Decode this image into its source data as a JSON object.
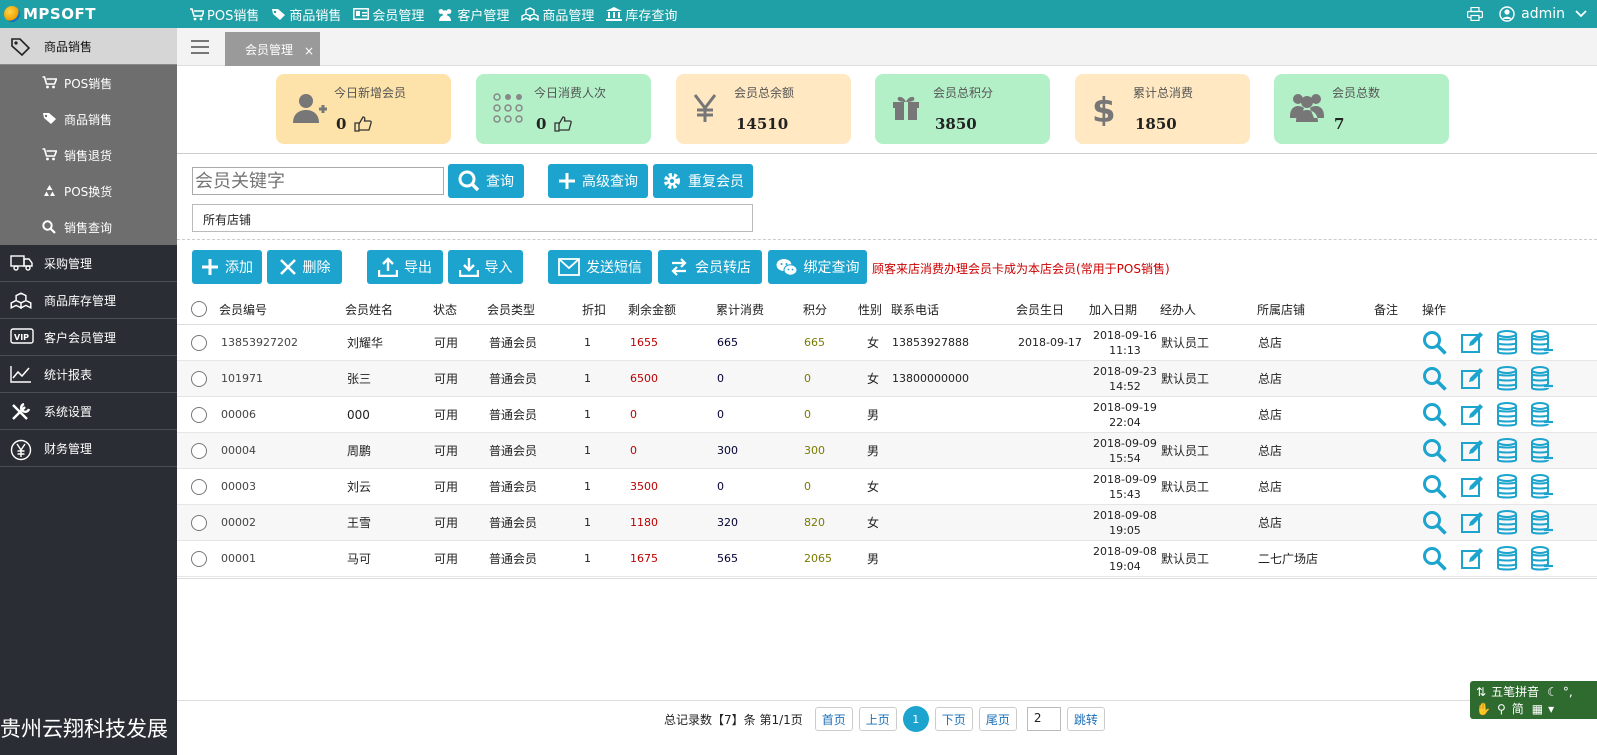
{
  "app": {
    "logo": "MPSOFT"
  },
  "topnav": [
    {
      "label": "POS销售",
      "icon": "cart-icon"
    },
    {
      "label": "商品销售",
      "icon": "tag-icon"
    },
    {
      "label": "会员管理",
      "icon": "id-card-icon"
    },
    {
      "label": "客户管理",
      "icon": "users-icon"
    },
    {
      "label": "商品管理",
      "icon": "cubes-icon"
    },
    {
      "label": "库存查询",
      "icon": "bank-icon"
    }
  ],
  "topright": {
    "user": "admin",
    "print_icon": "print-icon",
    "user_icon": "user-circle-icon",
    "dropdown_icon": "chevron-down-icon"
  },
  "sidebar": {
    "items": [
      {
        "label": "商品销售",
        "icon": "tags-icon",
        "active": true
      },
      {
        "label": "采购管理",
        "icon": "truck-icon"
      },
      {
        "label": "商品库存管理",
        "icon": "cubes-icon"
      },
      {
        "label": "客户会员管理",
        "icon": "vip-icon"
      },
      {
        "label": "统计报表",
        "icon": "line-chart-icon"
      },
      {
        "label": "系统设置",
        "icon": "tools-icon"
      },
      {
        "label": "财务管理",
        "icon": "yen-icon"
      }
    ],
    "subitems": [
      {
        "label": "POS销售",
        "icon": "cart-icon"
      },
      {
        "label": "商品销售",
        "icon": "tag-icon"
      },
      {
        "label": "销售退货",
        "icon": "cart-return-icon"
      },
      {
        "label": "POS换货",
        "icon": "recycle-icon"
      },
      {
        "label": "销售查询",
        "icon": "search-icon"
      }
    ],
    "footer_text": "贵州云翔科技发展"
  },
  "tabs": [
    {
      "label": "会员管理",
      "close": "×"
    }
  ],
  "stats": [
    {
      "title": "今日新增会员",
      "value": "0",
      "icon": "user-plus-icon",
      "color": "#fde3a9"
    },
    {
      "title": "今日消费人次",
      "value": "0",
      "icon": "dots-grid-icon",
      "color": "#b3f0c8"
    },
    {
      "title": "会员总余额",
      "value": "14510",
      "icon": "yen-icon",
      "color": "#ffe8c2"
    },
    {
      "title": "会员总积分",
      "value": "3850",
      "icon": "gift-icon",
      "color": "#b3f0c8"
    },
    {
      "title": "累计总消费",
      "value": "1850",
      "icon": "dollar-icon",
      "color": "#ffe8c2"
    },
    {
      "title": "会员总数",
      "value": "7",
      "icon": "group-icon",
      "color": "#b3f0c8"
    }
  ],
  "search": {
    "placeholder": "会员关键字",
    "query_label": "查询",
    "advanced_label": "高级查询",
    "duplicate_label": "重复会员",
    "store_selected": "所有店铺"
  },
  "toolbar": {
    "add": "添加",
    "delete": "删除",
    "export": "导出",
    "import": "导入",
    "sms": "发送短信",
    "transfer": "会员转店",
    "wechat": "绑定查询",
    "notice": "顾客来店消费办理会员卡成为本店会员(常用于POS销售)"
  },
  "table": {
    "headers": [
      "会员编号",
      "会员姓名",
      "状态",
      "会员类型",
      "折扣",
      "剩余金额",
      "累计消费",
      "积分",
      "性别",
      "联系电话",
      "会员生日",
      "加入日期",
      "经办人",
      "所属店铺",
      "备注",
      "操作"
    ],
    "rows": [
      {
        "id": "13853927202",
        "name": "刘耀华",
        "status": "可用",
        "type": "普通会员",
        "discount": "1",
        "balance": "1655",
        "total": "665",
        "points": "665",
        "gender": "女",
        "phone": "13853927888",
        "birthday": "2018-09-17",
        "join_date": "2018-09-16",
        "join_time": "11:13",
        "handler": "默认员工",
        "store": "总店",
        "note": ""
      },
      {
        "id": "101971",
        "name": "张三",
        "status": "可用",
        "type": "普通会员",
        "discount": "1",
        "balance": "6500",
        "total": "0",
        "points": "0",
        "gender": "女",
        "phone": "13800000000",
        "birthday": "",
        "join_date": "2018-09-23",
        "join_time": "14:52",
        "handler": "默认员工",
        "store": "总店",
        "note": ""
      },
      {
        "id": "00006",
        "name": "000",
        "status": "可用",
        "type": "普通会员",
        "discount": "1",
        "balance": "0",
        "total": "0",
        "points": "0",
        "gender": "男",
        "phone": "",
        "birthday": "",
        "join_date": "2018-09-19",
        "join_time": "22:04",
        "handler": "",
        "store": "总店",
        "note": ""
      },
      {
        "id": "00004",
        "name": "周鹏",
        "status": "可用",
        "type": "普通会员",
        "discount": "1",
        "balance": "0",
        "total": "300",
        "points": "300",
        "gender": "男",
        "phone": "",
        "birthday": "",
        "join_date": "2018-09-09",
        "join_time": "15:54",
        "handler": "默认员工",
        "store": "总店",
        "note": ""
      },
      {
        "id": "00003",
        "name": "刘云",
        "status": "可用",
        "type": "普通会员",
        "discount": "1",
        "balance": "3500",
        "total": "0",
        "points": "0",
        "gender": "女",
        "phone": "",
        "birthday": "",
        "join_date": "2018-09-09",
        "join_time": "15:43",
        "handler": "默认员工",
        "store": "总店",
        "note": ""
      },
      {
        "id": "00002",
        "name": "王雪",
        "status": "可用",
        "type": "普通会员",
        "discount": "1",
        "balance": "1180",
        "total": "320",
        "points": "820",
        "gender": "女",
        "phone": "",
        "birthday": "",
        "join_date": "2018-09-08",
        "join_time": "19:05",
        "handler": "",
        "store": "总店",
        "note": ""
      },
      {
        "id": "00001",
        "name": "马可",
        "status": "可用",
        "type": "普通会员",
        "discount": "1",
        "balance": "1675",
        "total": "565",
        "points": "2065",
        "gender": "男",
        "phone": "",
        "birthday": "",
        "join_date": "2018-09-08",
        "join_time": "19:04",
        "handler": "默认员工",
        "store": "二七广场店",
        "note": ""
      }
    ],
    "action_icons": [
      "search-icon",
      "edit-icon",
      "coins-icon",
      "coins-add-icon"
    ]
  },
  "pager": {
    "summary": "总记录数【7】条 第1/1页",
    "first": "首页",
    "prev": "上页",
    "current": "1",
    "next": "下页",
    "last": "尾页",
    "jump_value": "2",
    "jump": "跳转"
  },
  "ime": {
    "line1": "五笔拼音",
    "line2": "简"
  },
  "colors": {
    "accent": "#1fa0a6",
    "button": "#1ca4ce",
    "sidebar": "#2a2d33",
    "notice": "#cc0000"
  }
}
